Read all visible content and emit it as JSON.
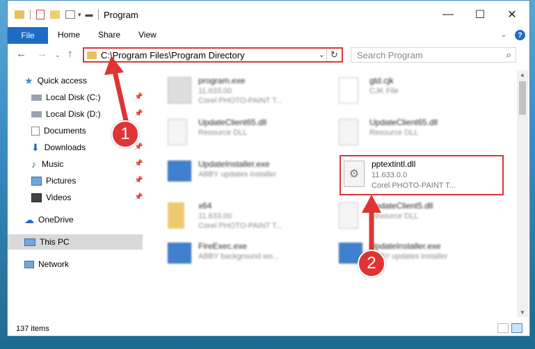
{
  "window": {
    "title": "Program",
    "controls": {
      "minimize": "—",
      "maximize": "☐",
      "close": "✕"
    }
  },
  "ribbon": {
    "file": "File",
    "tabs": [
      "Home",
      "Share",
      "View"
    ]
  },
  "address": {
    "path": "C:\\Program Files\\Program Directory"
  },
  "search": {
    "placeholder": "Search Program"
  },
  "sidebar": {
    "items": [
      {
        "label": "Quick access",
        "icon": "star-icon"
      },
      {
        "label": "Local Disk (C:)",
        "icon": "drive-icon"
      },
      {
        "label": "Local Disk (D:)",
        "icon": "drive-icon"
      },
      {
        "label": "Documents",
        "icon": "documents-icon"
      },
      {
        "label": "Downloads",
        "icon": "downloads-icon"
      },
      {
        "label": "Music",
        "icon": "music-icon"
      },
      {
        "label": "Pictures",
        "icon": "pictures-icon"
      },
      {
        "label": "Videos",
        "icon": "videos-icon"
      },
      {
        "label": "OneDrive",
        "icon": "cloud-icon"
      },
      {
        "label": "This PC",
        "icon": "computer-icon"
      },
      {
        "label": "Network",
        "icon": "network-icon"
      }
    ]
  },
  "files": [
    {
      "name": "program.exe",
      "line1": "11.633.00",
      "line2": "Corel PHOTO-PAINT T..."
    },
    {
      "name": "gtd.cjk",
      "line1": "CJK File",
      "line2": ""
    },
    {
      "name": "UpdateClient65.dll",
      "line1": "Resource DLL",
      "line2": ""
    },
    {
      "name": "UpdateClient65.dll",
      "line1": "Resource DLL",
      "line2": ""
    },
    {
      "name": "UpdateInstaller.exe",
      "line1": "ABBY updates installer",
      "line2": ""
    },
    {
      "name": "pptextintl.dll",
      "line1": "11.633.0.0",
      "line2": "Corel PHOTO-PAINT T..."
    },
    {
      "name": "x64",
      "line1": "11.633.00",
      "line2": "Corel PHOTO-PAINT T..."
    },
    {
      "name": "UpdateClient5.dll",
      "line1": "Resource DLL",
      "line2": ""
    },
    {
      "name": "FireExec.exe",
      "line1": "ABBY background wo...",
      "line2": ""
    },
    {
      "name": "UpdateInstaller.exe",
      "line1": "ABBY updates installer",
      "line2": ""
    }
  ],
  "status": {
    "count": "137 items"
  },
  "annotations": {
    "step1": "1",
    "step2": "2"
  },
  "colors": {
    "accent": "#1e6bc6",
    "highlight": "#e03434"
  }
}
